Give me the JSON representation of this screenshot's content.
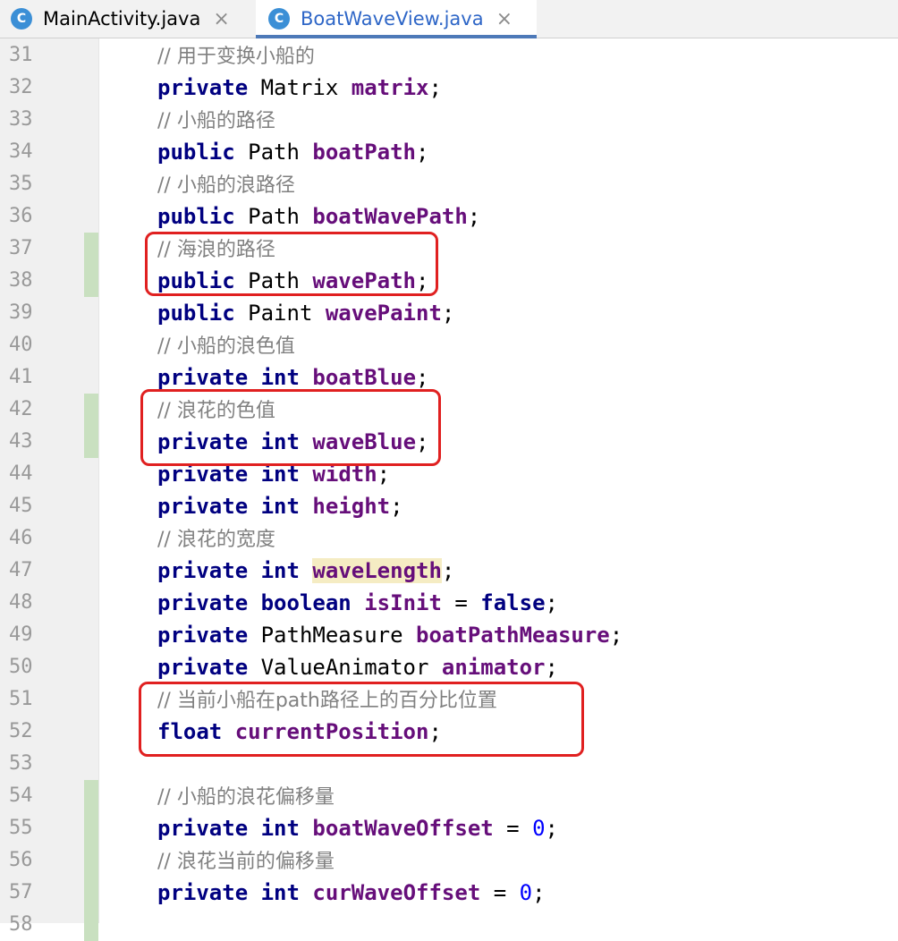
{
  "tabs": [
    {
      "label": "MainActivity.java",
      "icon": "c-class-icon",
      "active": false
    },
    {
      "label": "BoatWaveView.java",
      "icon": "c-class-icon",
      "active": true
    }
  ],
  "close_glyph": "×",
  "class_glyph": "C",
  "lines": [
    {
      "n": "31",
      "comment": "// 用于变换小船的"
    },
    {
      "n": "32",
      "kw": "private",
      "type": "Matrix",
      "field": "matrix",
      "tail": ";"
    },
    {
      "n": "33",
      "comment": "// 小船的路径"
    },
    {
      "n": "34",
      "kw": "public",
      "type": "Path",
      "field": "boatPath",
      "tail": ";"
    },
    {
      "n": "35",
      "comment": "// 小船的浪路径"
    },
    {
      "n": "36",
      "kw": "public",
      "type": "Path",
      "field": "boatWavePath",
      "tail": ";"
    },
    {
      "n": "37",
      "comment": "// 海浪的路径",
      "changed": true
    },
    {
      "n": "38",
      "kw": "public",
      "type": "Path",
      "field": "wavePath",
      "tail": ";",
      "changed": true
    },
    {
      "n": "39",
      "kw": "public",
      "type": "Paint",
      "field": "wavePaint",
      "tail": ";"
    },
    {
      "n": "40",
      "comment": "// 小船的浪色值"
    },
    {
      "n": "41",
      "kw": "private",
      "kw2": "int",
      "field": "boatBlue",
      "tail": ";"
    },
    {
      "n": "42",
      "comment": "// 浪花的色值",
      "changed": true
    },
    {
      "n": "43",
      "kw": "private",
      "kw2": "int",
      "field": "waveBlue",
      "tail": ";",
      "changed": true
    },
    {
      "n": "44",
      "kw": "private",
      "kw2": "int",
      "field": "width",
      "tail": ";"
    },
    {
      "n": "45",
      "kw": "private",
      "kw2": "int",
      "field": "height",
      "tail": ";"
    },
    {
      "n": "46",
      "comment": "// 浪花的宽度"
    },
    {
      "n": "47",
      "kw": "private",
      "kw2": "int",
      "field": "waveLength",
      "tail": ";",
      "highlight": true
    },
    {
      "n": "48",
      "kw": "private",
      "kw2": "boolean",
      "field": "isInit",
      "tail": " = ",
      "kw3": "false",
      "tail2": ";"
    },
    {
      "n": "49",
      "kw": "private",
      "type": "PathMeasure",
      "field": "boatPathMeasure",
      "tail": ";"
    },
    {
      "n": "50",
      "kw": "private",
      "type": "ValueAnimator",
      "field": "animator",
      "tail": ";"
    },
    {
      "n": "51",
      "comment": "// 当前小船在path路径上的百分比位置"
    },
    {
      "n": "52",
      "kw": "float",
      "field": "currentPosition",
      "tail": ";"
    },
    {
      "n": "53"
    },
    {
      "n": "54",
      "comment": "// 小船的浪花偏移量",
      "changed": true
    },
    {
      "n": "55",
      "kw": "private",
      "kw2": "int",
      "field": "boatWaveOffset",
      "tail": " = ",
      "num": "0",
      "tail2": ";",
      "changed": true
    },
    {
      "n": "56",
      "comment": "// 浪花当前的偏移量",
      "changed": true
    },
    {
      "n": "57",
      "kw": "private",
      "kw2": "int",
      "field": "curWaveOffset",
      "tail": " = ",
      "num": "0",
      "tail2": ";",
      "changed": true
    },
    {
      "n": "58",
      "changed": true
    }
  ],
  "annotation_boxes": [
    "wavePath-annotation",
    "waveBlue-annotation",
    "currentPosition-annotation"
  ],
  "colors": {
    "keyword": "#000080",
    "field": "#660e7a",
    "comment": "#808080",
    "number": "#0000ff",
    "annotation": "#e02020",
    "changed": "#c9e0c0"
  }
}
